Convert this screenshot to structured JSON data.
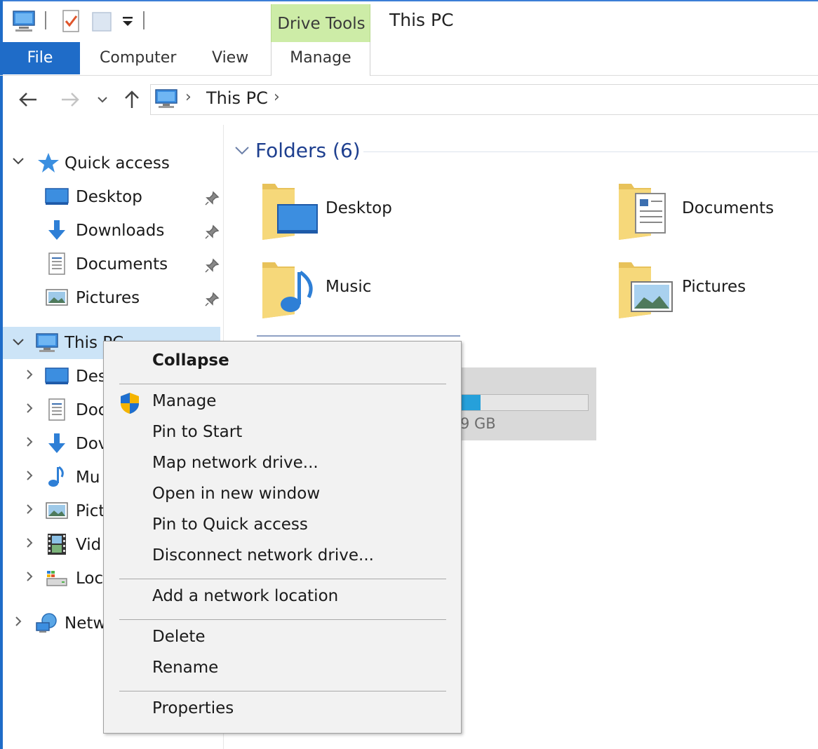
{
  "window": {
    "title": "This PC"
  },
  "ribbon": {
    "contextual_group": "Drive Tools",
    "tabs": [
      {
        "label": "File"
      },
      {
        "label": "Computer"
      },
      {
        "label": "View"
      },
      {
        "label": "Manage"
      }
    ]
  },
  "address_bar": {
    "path": [
      "This PC"
    ]
  },
  "quick_access_toolbar": {
    "icons": [
      "computer-icon",
      "properties-icon",
      "new-folder-icon",
      "customize-dropdown-icon"
    ]
  },
  "nav_pane": {
    "quick_access": {
      "label": "Quick access",
      "items": [
        {
          "label": "Desktop",
          "icon": "desktop-icon"
        },
        {
          "label": "Downloads",
          "icon": "downloads-icon"
        },
        {
          "label": "Documents",
          "icon": "documents-icon"
        },
        {
          "label": "Pictures",
          "icon": "pictures-icon"
        }
      ]
    },
    "this_pc": {
      "label": "This PC",
      "children": [
        {
          "label": "Des",
          "icon": "desktop-icon"
        },
        {
          "label": "Doc",
          "icon": "documents-icon"
        },
        {
          "label": "Dov",
          "icon": "downloads-icon"
        },
        {
          "label": "Mu",
          "icon": "music-icon"
        },
        {
          "label": "Pict",
          "icon": "pictures-icon"
        },
        {
          "label": "Vid",
          "icon": "videos-icon"
        },
        {
          "label": "Loc",
          "icon": "local-disk-icon"
        }
      ]
    },
    "network": {
      "label": "Netw"
    }
  },
  "main": {
    "folders_header": "Folders (6)",
    "folders": [
      {
        "label": "Desktop",
        "icon": "desktop-folder-icon"
      },
      {
        "label": "Documents",
        "icon": "documents-folder-icon"
      },
      {
        "label": "Music",
        "icon": "music-folder-icon"
      },
      {
        "label": "Pictures",
        "icon": "pictures-folder-icon"
      }
    ],
    "drive": {
      "size_text": "9 GB",
      "used_fraction": 0.16
    }
  },
  "context_menu": {
    "items": [
      {
        "label": "Collapse",
        "bold": true
      },
      {
        "label": "Manage",
        "icon": "uac-shield-icon"
      },
      {
        "label": "Pin to Start"
      },
      {
        "label": "Map network drive..."
      },
      {
        "label": "Open in new window"
      },
      {
        "label": "Pin to Quick access"
      },
      {
        "label": "Disconnect network drive..."
      },
      {
        "label": "Add a network location"
      },
      {
        "label": "Delete"
      },
      {
        "label": "Rename"
      },
      {
        "label": "Properties"
      }
    ]
  },
  "colors": {
    "accent": "#1f6cc8",
    "contextual_tab": "#cdeca7",
    "selection": "#cce4f7",
    "group_header": "#1e3f8f",
    "menu_bg": "#f2f2f2"
  }
}
